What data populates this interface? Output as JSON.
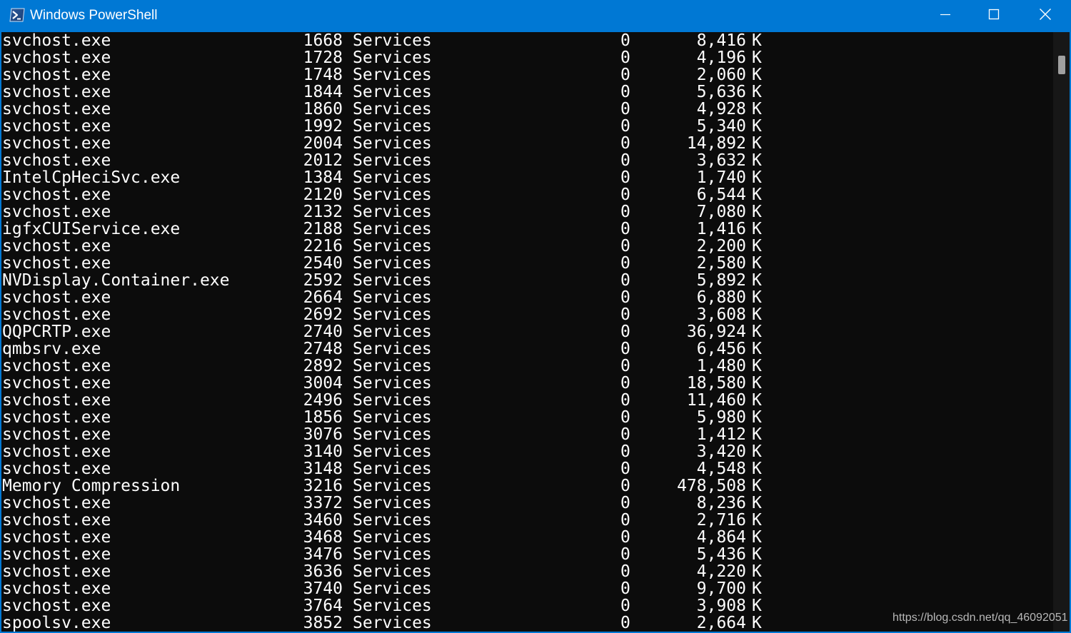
{
  "window": {
    "title": "Windows PowerShell",
    "accent_color": "#0078d4",
    "icons": {
      "app": "powershell-icon",
      "minimize": "minimize-icon",
      "maximize": "maximize-icon",
      "close": "close-icon"
    }
  },
  "console": {
    "background": "#0c0c0c",
    "foreground": "#ffffff",
    "rows": [
      {
        "name": "svchost.exe",
        "pid": "1668",
        "session": "Services",
        "num": "0",
        "mem": "8,416",
        "unit": "K"
      },
      {
        "name": "svchost.exe",
        "pid": "1728",
        "session": "Services",
        "num": "0",
        "mem": "4,196",
        "unit": "K"
      },
      {
        "name": "svchost.exe",
        "pid": "1748",
        "session": "Services",
        "num": "0",
        "mem": "2,060",
        "unit": "K"
      },
      {
        "name": "svchost.exe",
        "pid": "1844",
        "session": "Services",
        "num": "0",
        "mem": "5,636",
        "unit": "K"
      },
      {
        "name": "svchost.exe",
        "pid": "1860",
        "session": "Services",
        "num": "0",
        "mem": "4,928",
        "unit": "K"
      },
      {
        "name": "svchost.exe",
        "pid": "1992",
        "session": "Services",
        "num": "0",
        "mem": "5,340",
        "unit": "K"
      },
      {
        "name": "svchost.exe",
        "pid": "2004",
        "session": "Services",
        "num": "0",
        "mem": "14,892",
        "unit": "K"
      },
      {
        "name": "svchost.exe",
        "pid": "2012",
        "session": "Services",
        "num": "0",
        "mem": "3,632",
        "unit": "K"
      },
      {
        "name": "IntelCpHeciSvc.exe",
        "pid": "1384",
        "session": "Services",
        "num": "0",
        "mem": "1,740",
        "unit": "K"
      },
      {
        "name": "svchost.exe",
        "pid": "2120",
        "session": "Services",
        "num": "0",
        "mem": "6,544",
        "unit": "K"
      },
      {
        "name": "svchost.exe",
        "pid": "2132",
        "session": "Services",
        "num": "0",
        "mem": "7,080",
        "unit": "K"
      },
      {
        "name": "igfxCUIService.exe",
        "pid": "2188",
        "session": "Services",
        "num": "0",
        "mem": "1,416",
        "unit": "K"
      },
      {
        "name": "svchost.exe",
        "pid": "2216",
        "session": "Services",
        "num": "0",
        "mem": "2,200",
        "unit": "K"
      },
      {
        "name": "svchost.exe",
        "pid": "2540",
        "session": "Services",
        "num": "0",
        "mem": "2,580",
        "unit": "K"
      },
      {
        "name": "NVDisplay.Container.exe",
        "pid": "2592",
        "session": "Services",
        "num": "0",
        "mem": "5,892",
        "unit": "K"
      },
      {
        "name": "svchost.exe",
        "pid": "2664",
        "session": "Services",
        "num": "0",
        "mem": "6,880",
        "unit": "K"
      },
      {
        "name": "svchost.exe",
        "pid": "2692",
        "session": "Services",
        "num": "0",
        "mem": "3,608",
        "unit": "K"
      },
      {
        "name": "QQPCRTP.exe",
        "pid": "2740",
        "session": "Services",
        "num": "0",
        "mem": "36,924",
        "unit": "K"
      },
      {
        "name": "qmbsrv.exe",
        "pid": "2748",
        "session": "Services",
        "num": "0",
        "mem": "6,456",
        "unit": "K"
      },
      {
        "name": "svchost.exe",
        "pid": "2892",
        "session": "Services",
        "num": "0",
        "mem": "1,480",
        "unit": "K"
      },
      {
        "name": "svchost.exe",
        "pid": "3004",
        "session": "Services",
        "num": "0",
        "mem": "18,580",
        "unit": "K"
      },
      {
        "name": "svchost.exe",
        "pid": "2496",
        "session": "Services",
        "num": "0",
        "mem": "11,460",
        "unit": "K"
      },
      {
        "name": "svchost.exe",
        "pid": "1856",
        "session": "Services",
        "num": "0",
        "mem": "5,980",
        "unit": "K"
      },
      {
        "name": "svchost.exe",
        "pid": "3076",
        "session": "Services",
        "num": "0",
        "mem": "1,412",
        "unit": "K"
      },
      {
        "name": "svchost.exe",
        "pid": "3140",
        "session": "Services",
        "num": "0",
        "mem": "3,420",
        "unit": "K"
      },
      {
        "name": "svchost.exe",
        "pid": "3148",
        "session": "Services",
        "num": "0",
        "mem": "4,548",
        "unit": "K"
      },
      {
        "name": "Memory Compression",
        "pid": "3216",
        "session": "Services",
        "num": "0",
        "mem": "478,508",
        "unit": "K"
      },
      {
        "name": "svchost.exe",
        "pid": "3372",
        "session": "Services",
        "num": "0",
        "mem": "8,236",
        "unit": "K"
      },
      {
        "name": "svchost.exe",
        "pid": "3460",
        "session": "Services",
        "num": "0",
        "mem": "2,716",
        "unit": "K"
      },
      {
        "name": "svchost.exe",
        "pid": "3468",
        "session": "Services",
        "num": "0",
        "mem": "4,864",
        "unit": "K"
      },
      {
        "name": "svchost.exe",
        "pid": "3476",
        "session": "Services",
        "num": "0",
        "mem": "5,436",
        "unit": "K"
      },
      {
        "name": "svchost.exe",
        "pid": "3636",
        "session": "Services",
        "num": "0",
        "mem": "4,220",
        "unit": "K"
      },
      {
        "name": "svchost.exe",
        "pid": "3740",
        "session": "Services",
        "num": "0",
        "mem": "9,700",
        "unit": "K"
      },
      {
        "name": "svchost.exe",
        "pid": "3764",
        "session": "Services",
        "num": "0",
        "mem": "3,908",
        "unit": "K"
      },
      {
        "name": "spoolsv.exe",
        "pid": "3852",
        "session": "Services",
        "num": "0",
        "mem": "2,664",
        "unit": "K"
      }
    ]
  },
  "watermark": "https://blog.csdn.net/qq_46092051"
}
